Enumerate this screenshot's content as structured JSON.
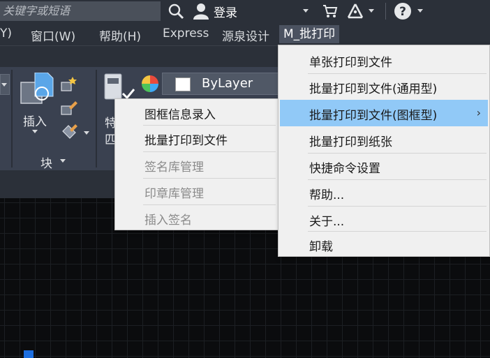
{
  "topbar": {
    "search_placeholder": "关键字或短语",
    "login_label": "登录"
  },
  "menubar": {
    "items": [
      {
        "label": "Y)"
      },
      {
        "label": "窗口(W)"
      },
      {
        "label": "帮助(H)"
      },
      {
        "label": "Express"
      },
      {
        "label": "源泉设计"
      },
      {
        "label": "M_批打印"
      }
    ]
  },
  "ribbon": {
    "insert_label": "插入",
    "block_label": "块",
    "feature_label_1": "特",
    "feature_label_2": "匹",
    "layer_value": "ByLayer"
  },
  "submenu": {
    "items": [
      {
        "label": "图框信息录入",
        "enabled": true
      },
      {
        "label": "批量打印到文件",
        "enabled": true
      },
      {
        "label": "签名库管理",
        "enabled": false
      },
      {
        "label": "印章库管理",
        "enabled": false
      },
      {
        "label": "插入签名",
        "enabled": false
      }
    ]
  },
  "mainmenu": {
    "items": [
      {
        "label": "单张打印到文件"
      },
      {
        "label": "批量打印到文件(通用型)"
      },
      {
        "label": "批量打印到文件(图框型)",
        "chevron": "›"
      },
      {
        "label": "批量打印到纸张"
      },
      {
        "label": "快捷命令设置"
      },
      {
        "label": "帮助..."
      },
      {
        "label": "关于..."
      },
      {
        "label": "卸载"
      }
    ]
  },
  "colors": {
    "highlight": "#91c9f7",
    "menu_bg": "#f0f0f0",
    "ribbon_bg": "#3a4150",
    "chrome_bg": "#2b3039"
  }
}
